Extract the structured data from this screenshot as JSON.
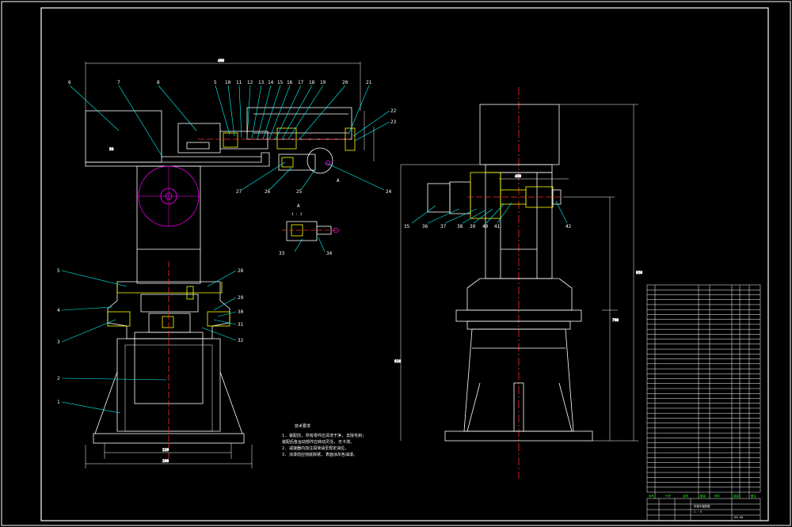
{
  "colors": {
    "background": "#000000",
    "outline": "#ffffff",
    "leader": "#00ffff",
    "centerline": "#ff2a2a",
    "hatch": "#ffff00",
    "dimension": "#ffffff",
    "flywheel": "#ff00ff",
    "table_text": "#22ff22"
  },
  "front_view": {
    "left_labels": [
      "6",
      "7",
      "8",
      "5",
      "4",
      "3",
      "2",
      "1"
    ],
    "top_labels": [
      "5",
      "10",
      "11",
      "12",
      "13",
      "14",
      "15",
      "16",
      "17",
      "18",
      "19",
      "20",
      "21"
    ],
    "right_labels": [
      "22",
      "23"
    ],
    "lower_right_labels": [
      "28",
      "29",
      "30",
      "31",
      "32"
    ],
    "bottom_labels": [
      "27",
      "26",
      "25",
      "24"
    ],
    "section_marker": "A",
    "dimensions": [
      "480",
      "50",
      "220",
      "200"
    ]
  },
  "section_view": {
    "title_letter": "A",
    "title_ratio": "1 : 2",
    "labels": [
      "33",
      "34"
    ]
  },
  "side_view": {
    "labels": [
      "35",
      "36",
      "37",
      "38",
      "39",
      "40",
      "41",
      "42"
    ],
    "dimensions": [
      "430",
      "950",
      "760",
      "810"
    ]
  },
  "notes": {
    "title": "技术要求",
    "lines": [
      "1. 装配前, 所有零件应清洗干净, 去除毛刺;",
      "   装配后各运动部件应转动灵活, 无卡滞。",
      "2. 减速器内加注润滑油至规定油位。",
      "3. 涂漆前应彻底除锈, 表面涂灰色油漆。"
    ]
  },
  "parts_table": {
    "row_count": 42,
    "header": [
      "序号",
      "代号",
      "名称",
      "数量",
      "材料",
      "重量",
      "备注"
    ]
  },
  "title_block": {
    "drawing_name": "机械手装配图",
    "drawing_number": "JXS-00",
    "scale": "1 : 5"
  }
}
